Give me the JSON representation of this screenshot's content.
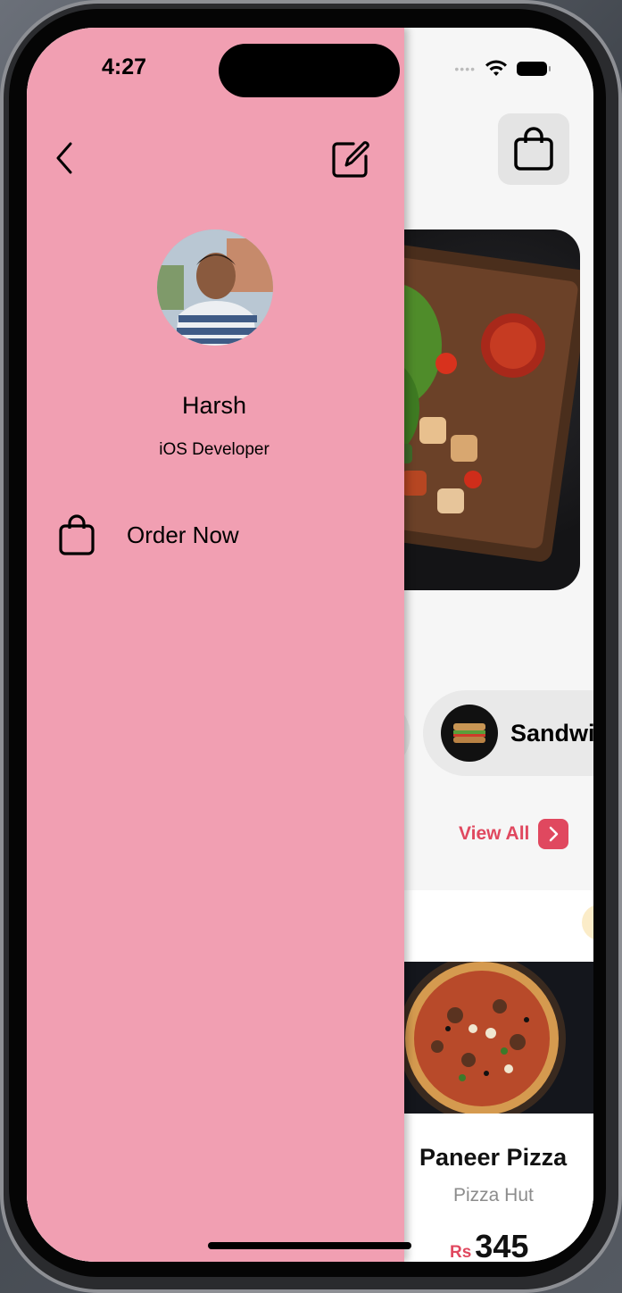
{
  "status_bar": {
    "time": "4:27",
    "signal": "••••"
  },
  "menu": {
    "user": {
      "name": "Harsh",
      "role": "iOS Developer"
    },
    "items": [
      {
        "label": "Order Now",
        "icon": "bag-icon"
      }
    ]
  },
  "main": {
    "category": {
      "label": "Sandwi"
    },
    "view_all_label": "View All",
    "card": {
      "title": "Paneer Pizza",
      "restaurant": "Pizza Hut",
      "currency": "Rs",
      "price": "345"
    }
  },
  "colors": {
    "menu_bg": "#f19fb2",
    "accent": "#e0485f"
  }
}
